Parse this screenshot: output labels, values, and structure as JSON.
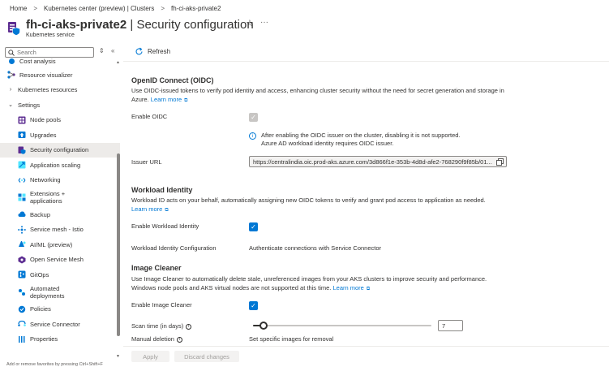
{
  "breadcrumb": {
    "items": [
      "Home",
      "Kubernetes center (preview) | Clusters",
      "fh-ci-aks-private2"
    ],
    "separator": ">"
  },
  "header": {
    "title_bold": "fh-ci-aks-private2",
    "title_rest": " | Security configuration",
    "subtitle": "Kubernetes service",
    "star_icon": "☆",
    "more_icon": "···"
  },
  "sidebar": {
    "search_placeholder": "Search",
    "items": [
      {
        "label": "Cost analysis",
        "icon": "cost-analysis-icon"
      },
      {
        "label": "Resource visualizer",
        "icon": "resource-visualizer-icon"
      },
      {
        "label": "Kubernetes resources",
        "chevron": "›"
      },
      {
        "label": "Settings",
        "chevron": "⌄"
      },
      {
        "label": "Node pools",
        "icon": "node-pools-icon"
      },
      {
        "label": "Upgrades",
        "icon": "upgrades-icon"
      },
      {
        "label": "Security configuration",
        "icon": "security-icon"
      },
      {
        "label": "Application scaling",
        "icon": "scaling-icon"
      },
      {
        "label": "Networking",
        "icon": "networking-icon"
      },
      {
        "label": "Extensions +",
        "label2": "applications",
        "icon": "extensions-icon"
      },
      {
        "label": "Backup",
        "icon": "backup-icon"
      },
      {
        "label": "Service mesh - Istio",
        "icon": "service-mesh-icon"
      },
      {
        "label": "AI/ML (preview)",
        "icon": "aiml-icon"
      },
      {
        "label": "Open Service Mesh",
        "icon": "open-service-mesh-icon"
      },
      {
        "label": "GitOps",
        "icon": "gitops-icon"
      },
      {
        "label": "Automated",
        "label2": "deployments",
        "icon": "automated-deployments-icon"
      },
      {
        "label": "Policies",
        "icon": "policies-icon"
      },
      {
        "label": "Service Connector",
        "icon": "service-connector-icon"
      },
      {
        "label": "Properties",
        "icon": "properties-icon"
      }
    ],
    "fav_hint": "Add or remove favorites by pressing Ctrl+Shift+F"
  },
  "toolbar": {
    "refresh_label": "Refresh"
  },
  "oidc": {
    "title": "OpenID Connect (OIDC)",
    "desc": "Use OIDC-issued tokens to verify pod identity and access, enhancing cluster security without the need for secret generation and storage in Azure.",
    "learn_more": "Learn more",
    "enable_label": "Enable OIDC",
    "info_line1": "After enabling the OIDC issuer on the cluster, disabling it is not supported.",
    "info_line2": "Azure AD workload identity requires OIDC issuer.",
    "issuer_label": "Issuer URL",
    "issuer_url": "https://centralindia.oic.prod-aks.azure.com/3d866f1e-353b-4d8d-afe2-768290f9f85b/01..."
  },
  "workload": {
    "title": "Workload Identity",
    "desc": "Workload ID acts on your behalf, automatically assigning new OIDC tokens to verify and grant pod access to application as needed.",
    "learn_more": "Learn more",
    "enable_label": "Enable Workload Identity",
    "config_label": "Workload Identity Configuration",
    "config_link": "Authenticate connections with Service Connector"
  },
  "image_cleaner": {
    "title": "Image Cleaner",
    "desc": "Use Image Cleaner to automatically delete stale, unreferenced images from your AKS clusters to improve security and performance. Windows node pools and AKS virtual nodes are not supported at this time.",
    "learn_more": "Learn more",
    "enable_label": "Enable Image Cleaner",
    "scan_label": "Scan time (in days)",
    "scan_value": "7",
    "scan_fraction": 0.06,
    "manual_label": "Manual deletion",
    "manual_link": "Set specific images for removal"
  },
  "footer": {
    "apply_label": "Apply",
    "discard_label": "Discard changes"
  },
  "colors": {
    "accent": "#0078d4",
    "disabled": "#c8c6c4"
  }
}
